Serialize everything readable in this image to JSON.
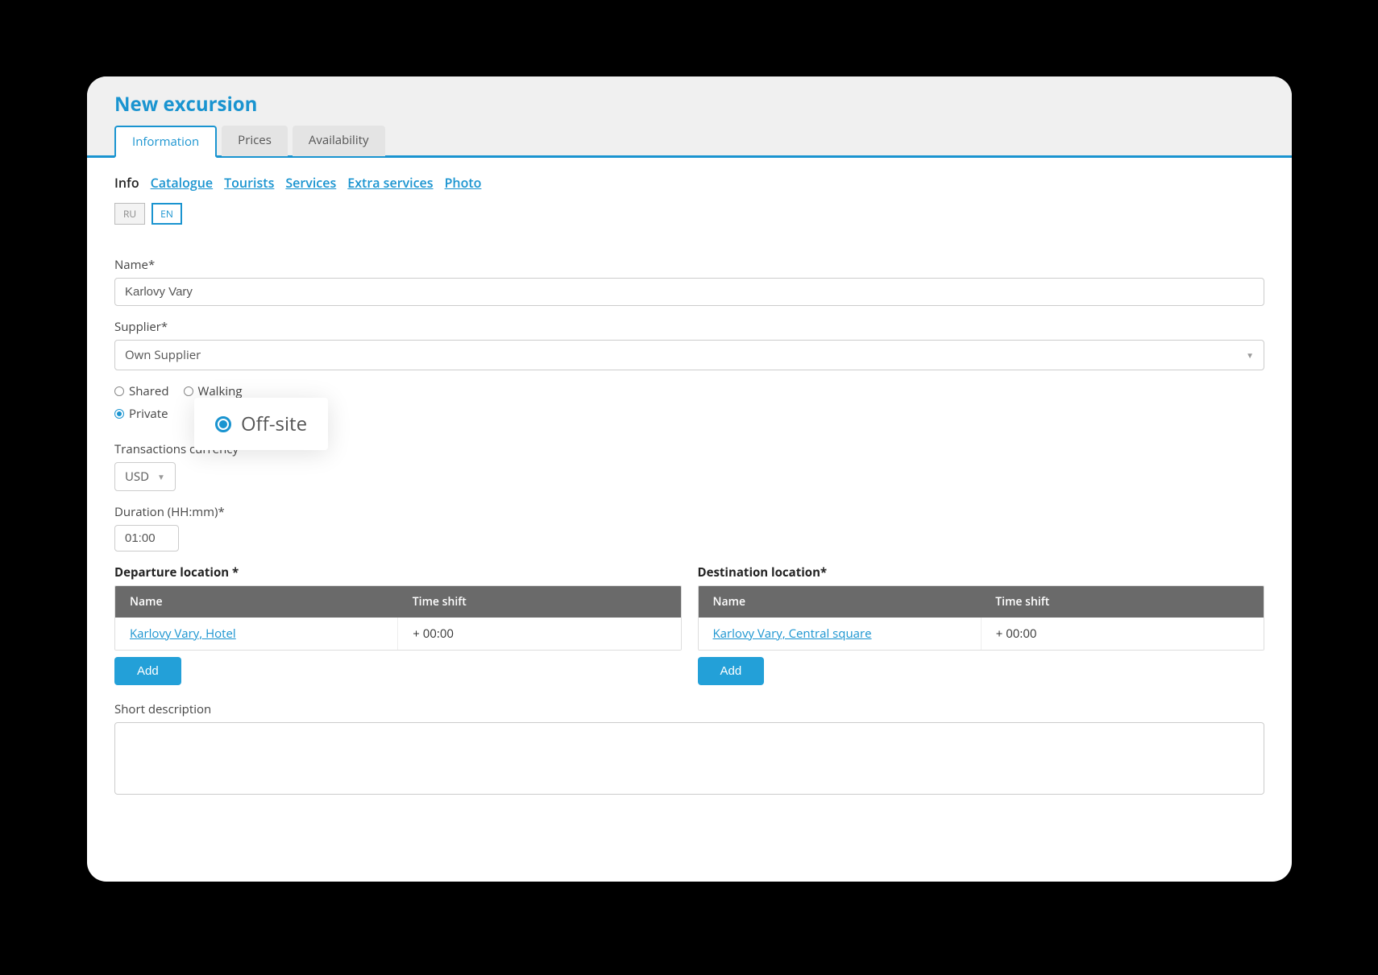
{
  "page_title": "New excursion",
  "tabs": {
    "information": "Information",
    "prices": "Prices",
    "availability": "Availability"
  },
  "subnav": {
    "info": "Info",
    "catalogue": "Catalogue",
    "tourists": "Tourists",
    "services": "Services",
    "extra_services": "Extra services",
    "photo": "Photo"
  },
  "lang": {
    "ru": "RU",
    "en": "EN"
  },
  "labels": {
    "name": "Name*",
    "supplier": "Supplier*",
    "transactions_currency": "Transactions currency*",
    "duration": "Duration (HH:mm)*",
    "departure_location": "Departure location *",
    "destination_location": "Destination location*",
    "short_description": "Short description"
  },
  "values": {
    "name": "Karlovy Vary",
    "supplier": "Own Supplier",
    "currency": "USD",
    "duration": "01:00",
    "short_description": ""
  },
  "radios": {
    "shared": "Shared",
    "private": "Private",
    "walking": "Walking",
    "offsite": "Off-site"
  },
  "table_headers": {
    "name": "Name",
    "time_shift": "Time shift"
  },
  "departure": {
    "name": "Karlovy Vary, Hotel",
    "time_shift": "+ 00:00"
  },
  "destination": {
    "name": "Karlovy Vary, Central square",
    "time_shift": "+ 00:00"
  },
  "buttons": {
    "add": "Add"
  }
}
